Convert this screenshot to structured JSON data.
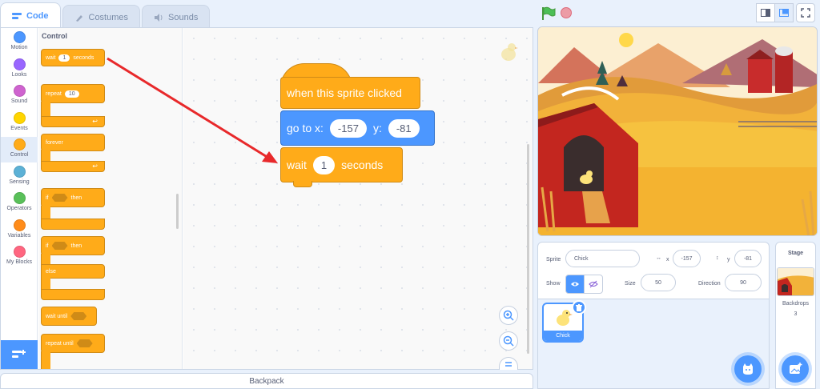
{
  "tabs": [
    {
      "label": "Code",
      "icon": "code-icon",
      "active": true
    },
    {
      "label": "Costumes",
      "icon": "brush-icon",
      "active": false
    },
    {
      "label": "Sounds",
      "icon": "speaker-icon",
      "active": false
    }
  ],
  "categories": [
    {
      "label": "Motion",
      "color": "#4c97ff"
    },
    {
      "label": "Looks",
      "color": "#9966ff"
    },
    {
      "label": "Sound",
      "color": "#cf63cf"
    },
    {
      "label": "Events",
      "color": "#ffd500"
    },
    {
      "label": "Control",
      "color": "#ffab19",
      "active": true
    },
    {
      "label": "Sensing",
      "color": "#5cb1d6"
    },
    {
      "label": "Operators",
      "color": "#59c059"
    },
    {
      "label": "Variables",
      "color": "#ff8c1a"
    },
    {
      "label": "My Blocks",
      "color": "#ff6680"
    }
  ],
  "palette": {
    "title": "Control",
    "wait": {
      "text": "wait",
      "value": "1",
      "suffix": "seconds"
    },
    "repeat": {
      "text": "repeat",
      "value": "10"
    },
    "forever": "forever",
    "if_then": {
      "if": "if",
      "then": "then"
    },
    "if_else": {
      "if": "if",
      "then": "then",
      "else": "else"
    },
    "wait_until": "wait until",
    "repeat_until": "repeat until"
  },
  "script": {
    "hat": "when this sprite clicked",
    "goto": {
      "label": "go to x:",
      "x": "-157",
      "ylabel": "y:",
      "y": "-81"
    },
    "wait": {
      "label": "wait",
      "value": "1",
      "suffix": "seconds"
    }
  },
  "backpack": "Backpack",
  "sprite_info": {
    "sprite_label": "Sprite",
    "sprite_name": "Chick",
    "x_label": "x",
    "x": "-157",
    "y_label": "y",
    "y": "-81",
    "show_label": "Show",
    "size_label": "Size",
    "size": "50",
    "direction_label": "Direction",
    "direction": "90"
  },
  "sprite_tile": {
    "name": "Chick"
  },
  "stage_pane": {
    "title": "Stage",
    "backdrops_label": "Backdrops",
    "backdrops_count": "3"
  },
  "colors": {
    "accent": "#4c97ff",
    "control": "#ffab19",
    "annotation": "#e8292b"
  }
}
